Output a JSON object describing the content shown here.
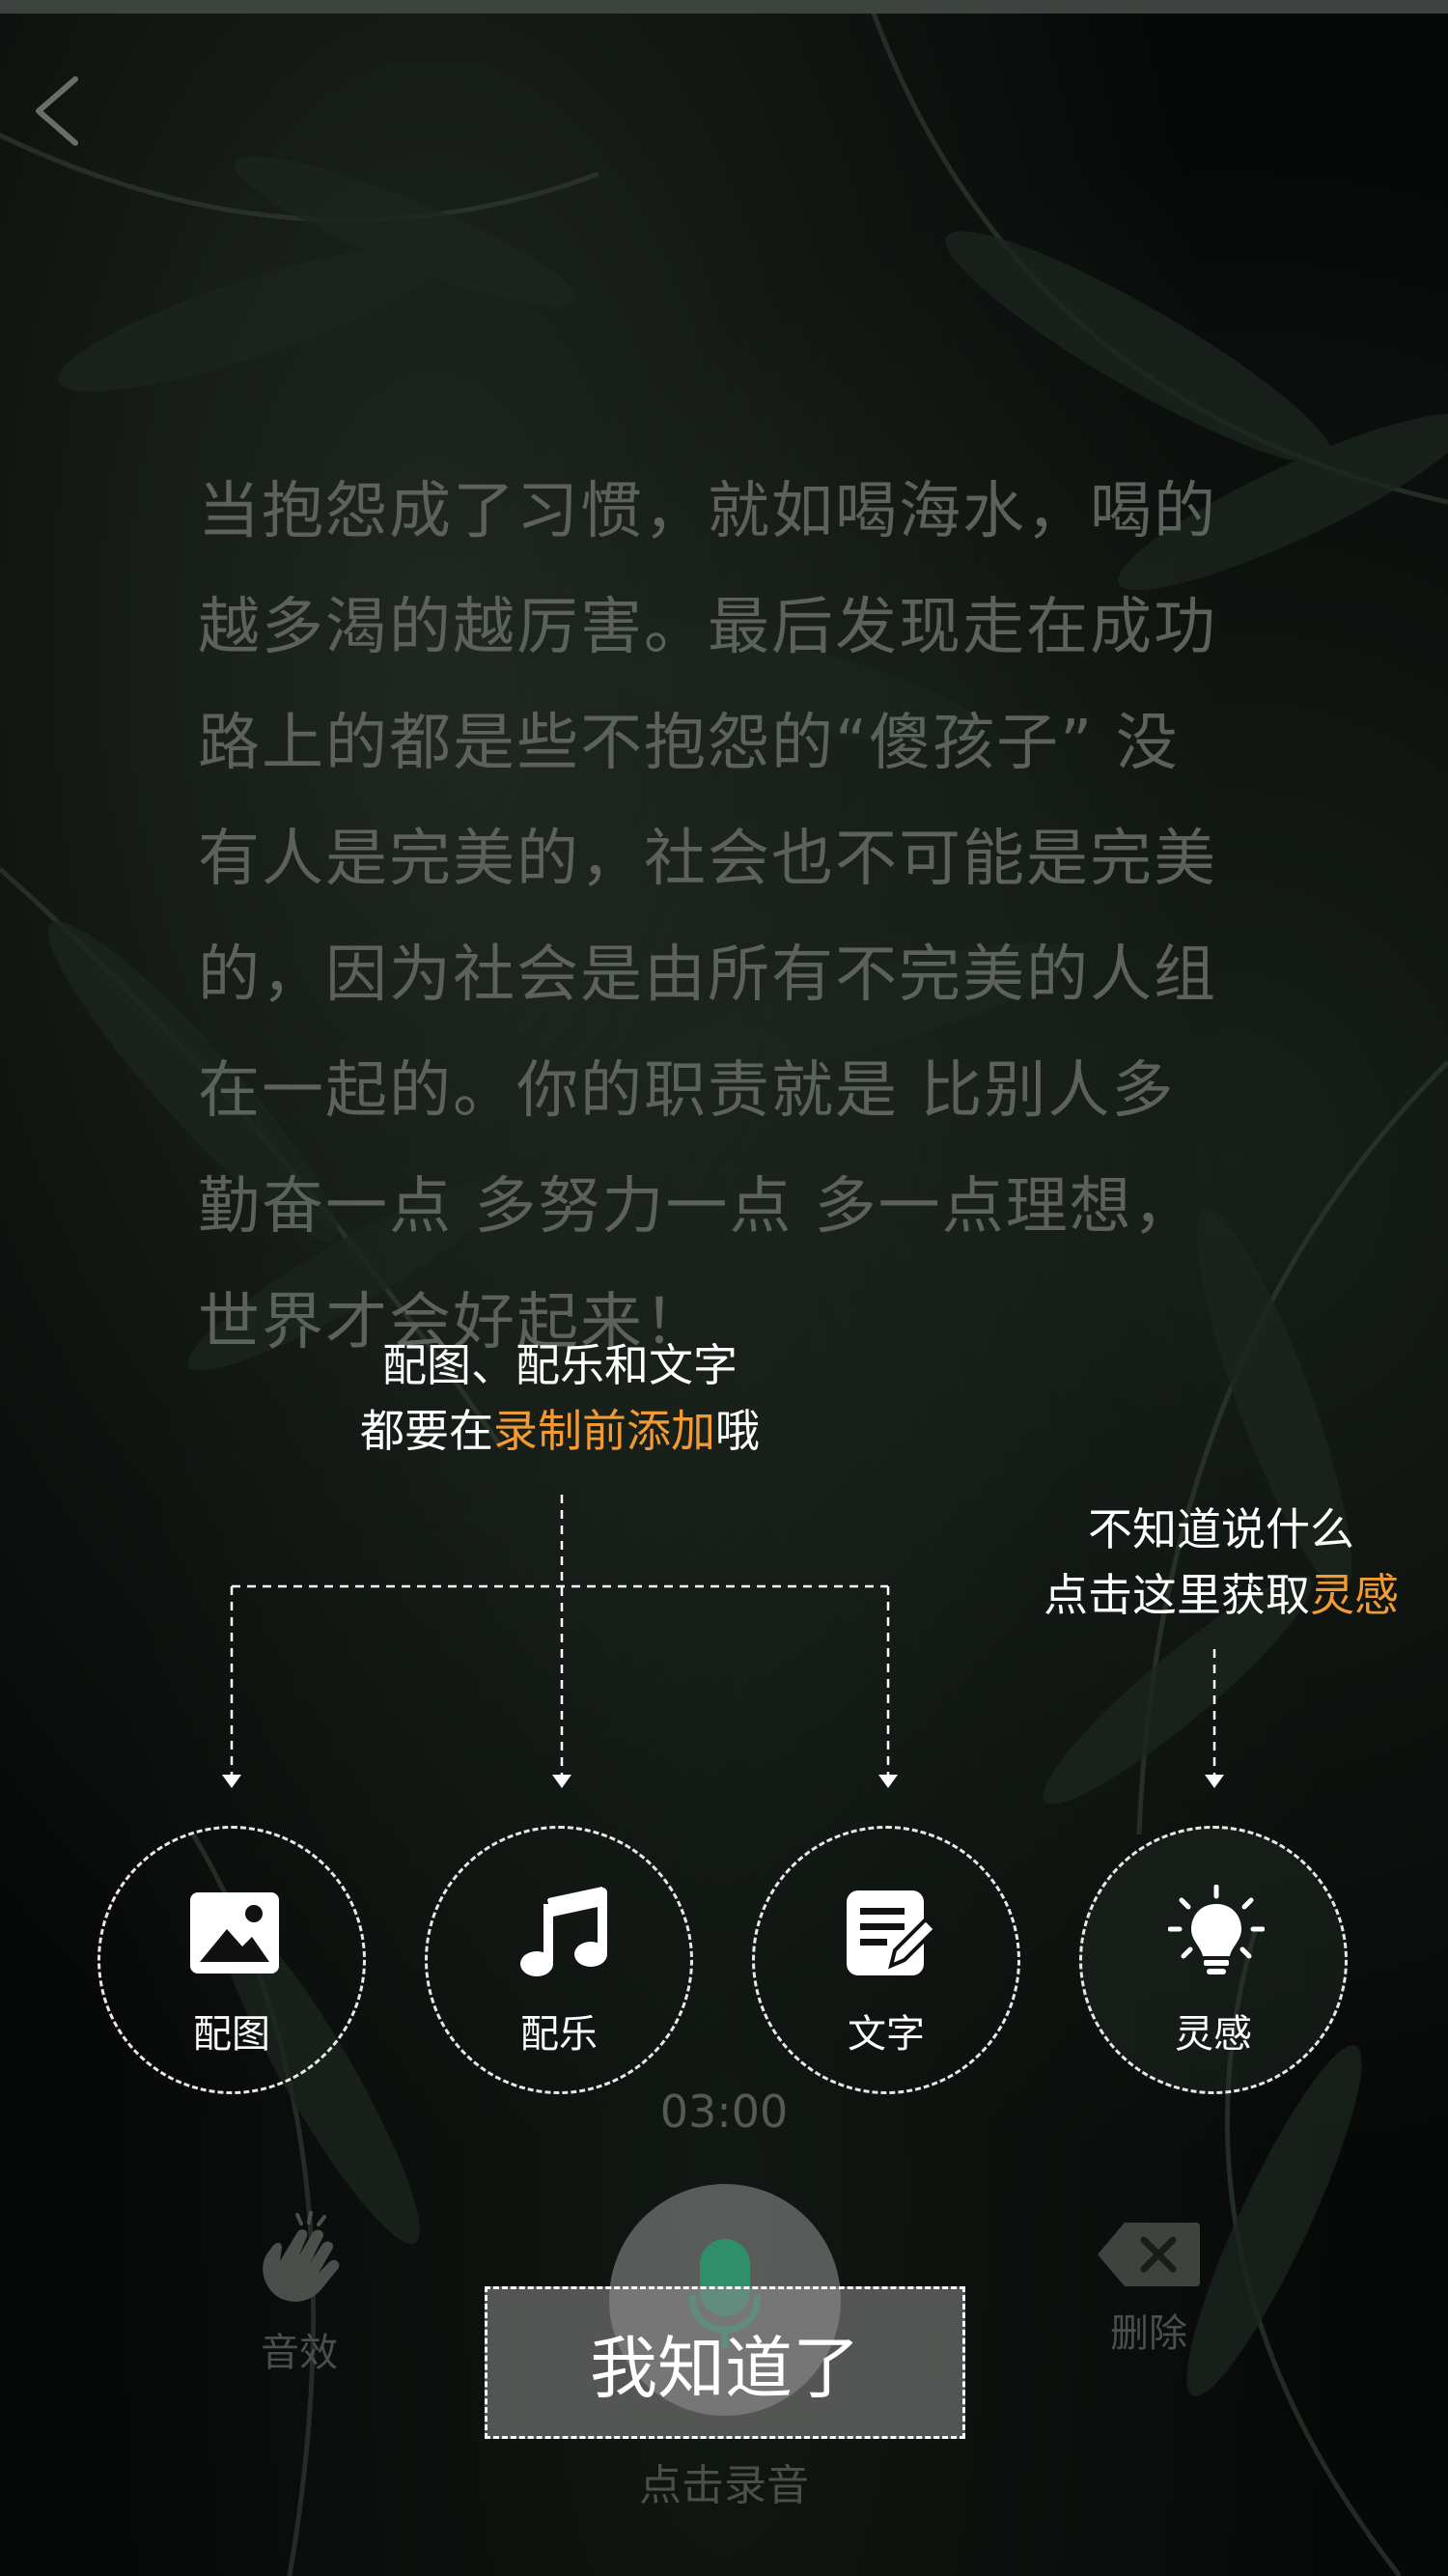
{
  "header": {
    "back_icon": "chevron-left-icon"
  },
  "quote": {
    "lines": [
      "当抱怨成了习惯，就如喝海水，喝的",
      "越多渴的越厉害。最后发现走在成功",
      "路上的都是些不抱怨的“傻孩子” 没",
      "有人是完美的，社会也不可能是完美",
      "的，因为社会是由所有不完美的人组",
      "在一起的。你的职责就是 比别人多",
      "勤奋一点 多努力一点 多一点理想，",
      "世界才会好起来！"
    ]
  },
  "guide": {
    "tip_add": {
      "line1": "配图、配乐和文字",
      "line2_prefix": "都要在",
      "line2_highlight": "录制前添加",
      "line2_suffix": "哦"
    },
    "tip_inspire": {
      "line1": "不知道说什么",
      "line2_prefix": "点击这里获取",
      "line2_highlight": "灵感"
    },
    "highlight_color": "#f29a33",
    "actions": [
      {
        "label": "配图",
        "icon": "image-icon"
      },
      {
        "label": "配乐",
        "icon": "music-note-icon"
      },
      {
        "label": "文字",
        "icon": "edit-text-icon"
      },
      {
        "label": "灵感",
        "icon": "lightbulb-icon"
      }
    ],
    "confirm_button": "我知道了"
  },
  "recorder": {
    "timer": "03:00",
    "sound_effect_label": "音效",
    "sound_effect_icon": "clapping-hands-icon",
    "delete_label": "删除",
    "delete_icon": "backspace-icon",
    "mic_icon": "microphone-icon",
    "record_label": "点击录音"
  }
}
